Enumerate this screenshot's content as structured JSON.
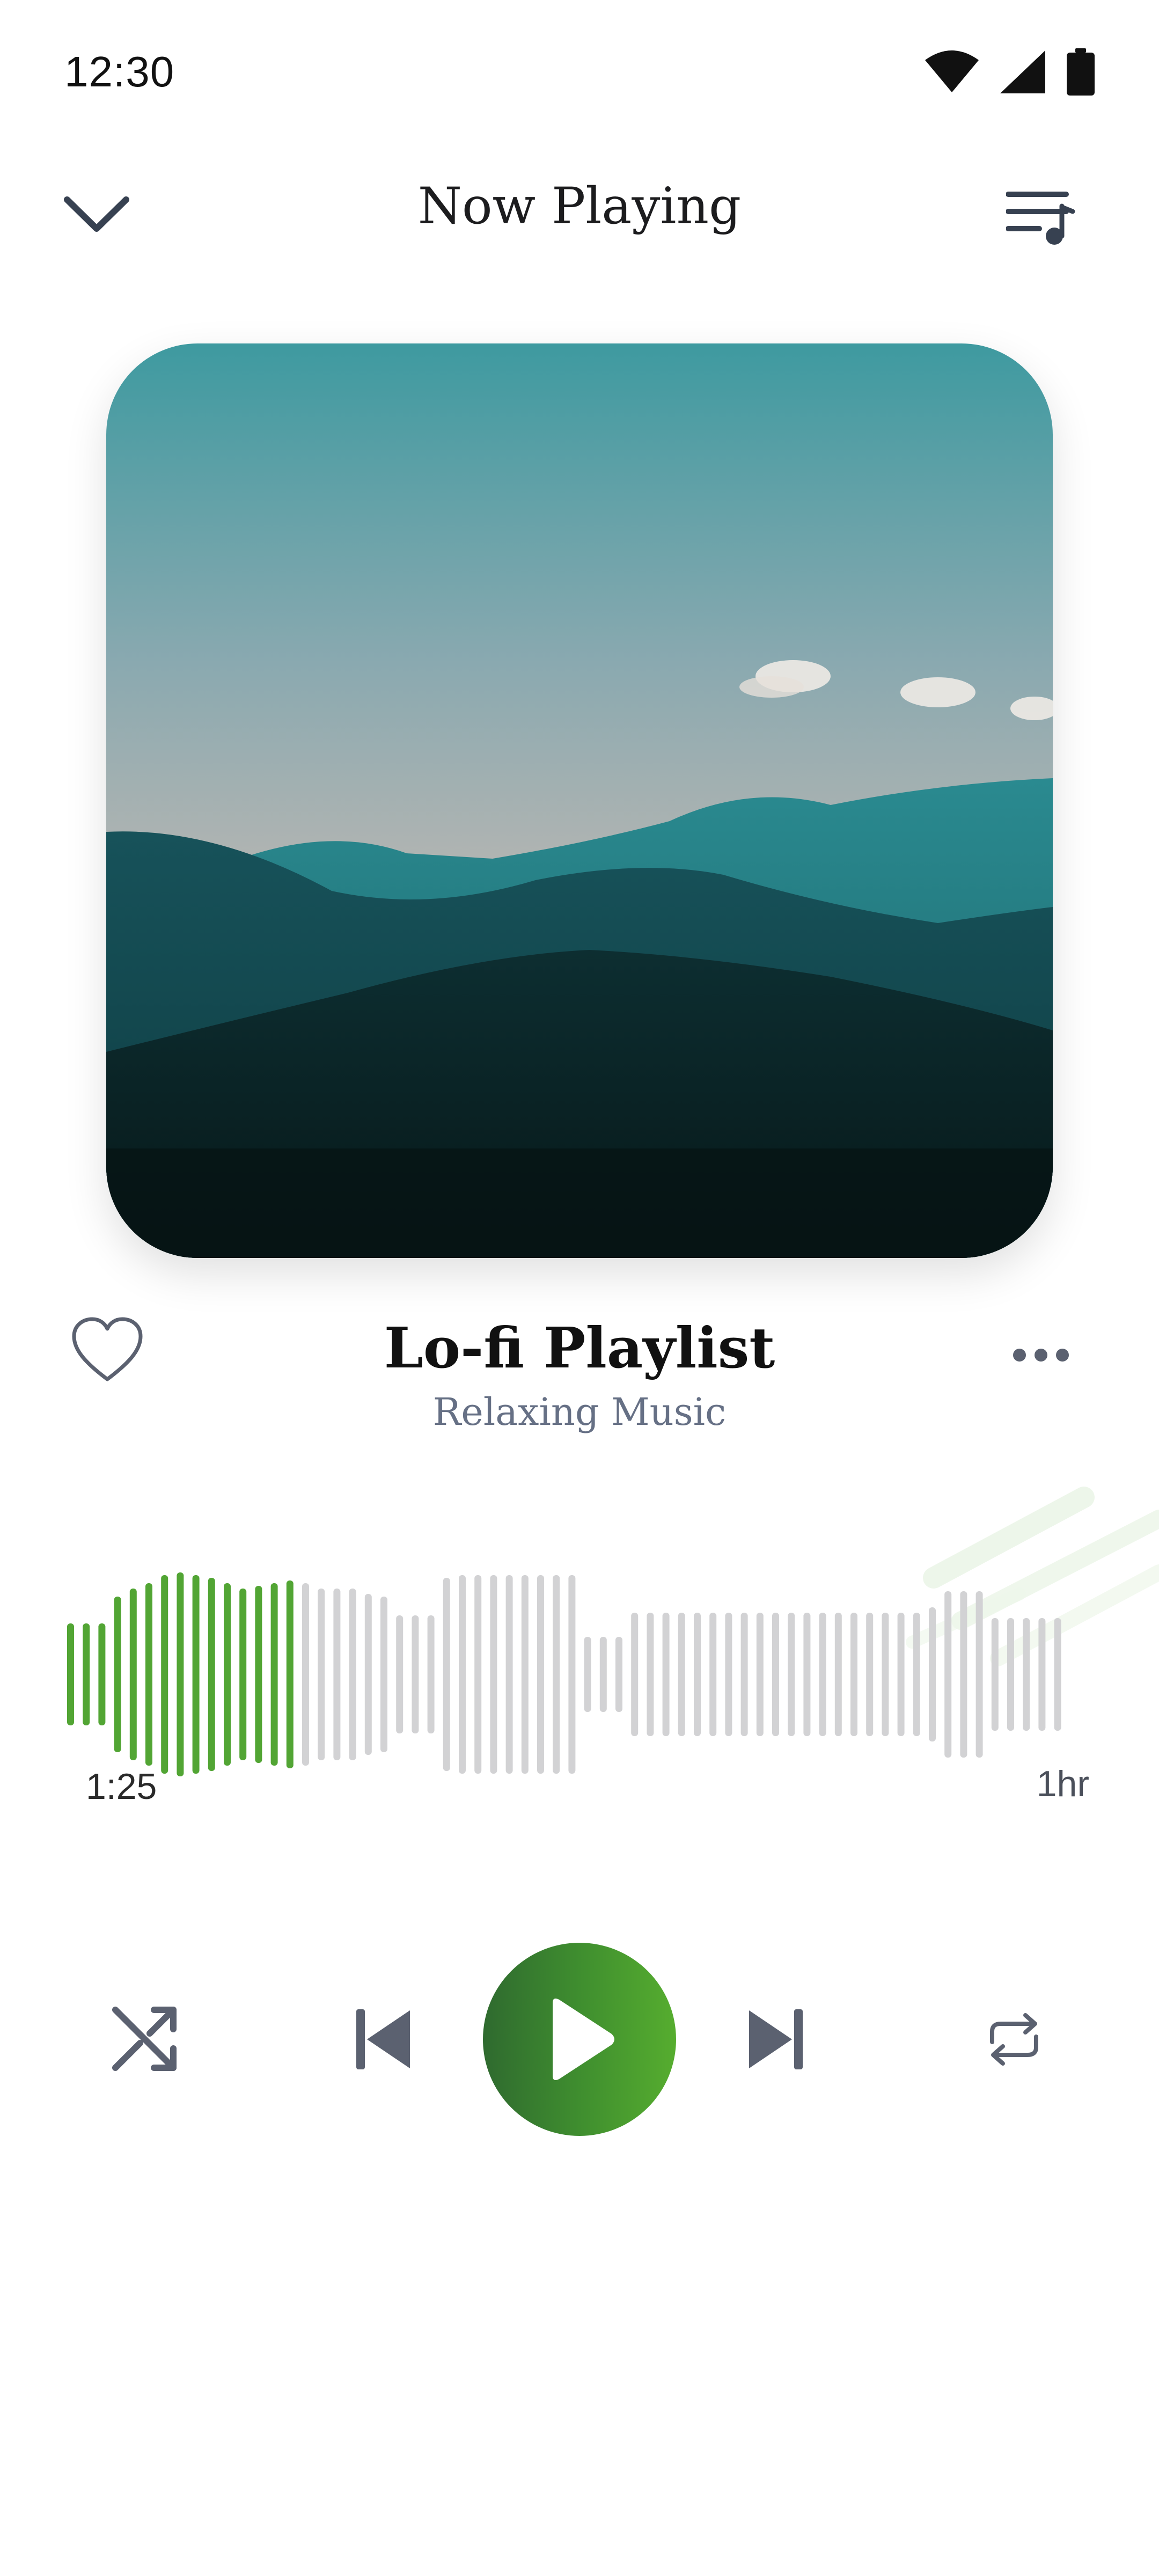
{
  "status_bar": {
    "time": "12:30",
    "icons": [
      "wifi-icon",
      "cellular-signal-icon",
      "battery-icon"
    ]
  },
  "header": {
    "title": "Now Playing",
    "left_icon": "chevron-down-icon",
    "right_icon": "queue-music-icon"
  },
  "album_art": {
    "description_icon": "mountain-landscape-image"
  },
  "track": {
    "title": "Lo-fi Playlist",
    "artist": "Relaxing Music",
    "liked": false
  },
  "progress": {
    "current_time": "1:25",
    "total_time": "1hr",
    "played_fraction": 0.23
  },
  "controls": {
    "shuffle_icon": "shuffle-icon",
    "previous_icon": "skip-previous-icon",
    "play_icon": "play-icon",
    "next_icon": "skip-next-icon",
    "repeat_icon": "repeat-icon"
  },
  "colors": {
    "accent": "#4a9c2f",
    "played_bar": "#52a534",
    "unplayed_bar": "#d2d2d4",
    "icon_gray": "#5b6170",
    "title_text": "#111111",
    "subtitle_text": "#667085"
  }
}
